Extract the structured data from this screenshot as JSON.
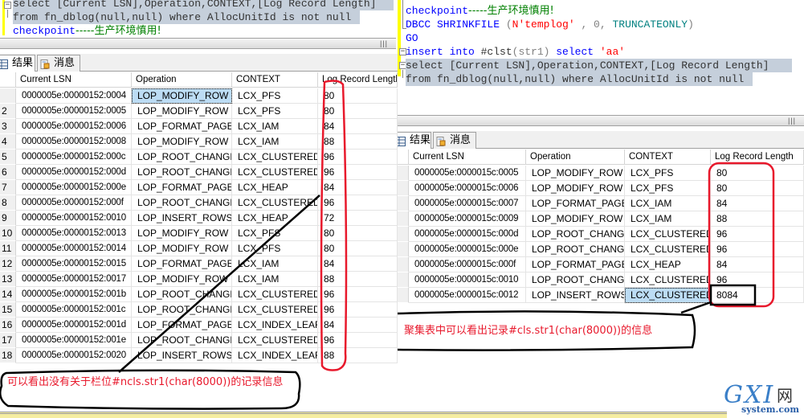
{
  "left": {
    "editor": {
      "line1": "select [Current LSN],Operation,CONTEXT,[Log Record Length]",
      "line2": "from fn_dblog(null,null) where AllocUnitId is not null",
      "line3_kw": "checkpoint",
      "line3_comment": "-----生产环境慎用!"
    },
    "tabs": [
      {
        "label": "结果",
        "icon": "grid-icon"
      },
      {
        "label": "消息",
        "icon": "message-icon"
      }
    ],
    "columns": [
      "Current LSN",
      "Operation",
      "CONTEXT",
      "Log Record Length"
    ],
    "rows": [
      {
        "n": "",
        "lsn": "0000005e:00000152:0004",
        "op": "LOP_MODIFY_ROW",
        "ctx": "LCX_PFS",
        "len": "80"
      },
      {
        "n": "2",
        "lsn": "0000005e:00000152:0005",
        "op": "LOP_MODIFY_ROW",
        "ctx": "LCX_PFS",
        "len": "80"
      },
      {
        "n": "3",
        "lsn": "0000005e:00000152:0006",
        "op": "LOP_FORMAT_PAGE",
        "ctx": "LCX_IAM",
        "len": "84"
      },
      {
        "n": "4",
        "lsn": "0000005e:00000152:0008",
        "op": "LOP_MODIFY_ROW",
        "ctx": "LCX_IAM",
        "len": "88"
      },
      {
        "n": "5",
        "lsn": "0000005e:00000152:000c",
        "op": "LOP_ROOT_CHANGE",
        "ctx": "LCX_CLUSTERED",
        "len": "96"
      },
      {
        "n": "6",
        "lsn": "0000005e:00000152:000d",
        "op": "LOP_ROOT_CHANGE",
        "ctx": "LCX_CLUSTERED",
        "len": "96"
      },
      {
        "n": "7",
        "lsn": "0000005e:00000152:000e",
        "op": "LOP_FORMAT_PAGE",
        "ctx": "LCX_HEAP",
        "len": "84"
      },
      {
        "n": "8",
        "lsn": "0000005e:00000152:000f",
        "op": "LOP_ROOT_CHANGE",
        "ctx": "LCX_CLUSTERED",
        "len": "96"
      },
      {
        "n": "9",
        "lsn": "0000005e:00000152:0010",
        "op": "LOP_INSERT_ROWS",
        "ctx": "LCX_HEAP",
        "len": "72"
      },
      {
        "n": "10",
        "lsn": "0000005e:00000152:0013",
        "op": "LOP_MODIFY_ROW",
        "ctx": "LCX_PFS",
        "len": "80"
      },
      {
        "n": "11",
        "lsn": "0000005e:00000152:0014",
        "op": "LOP_MODIFY_ROW",
        "ctx": "LCX_PFS",
        "len": "80"
      },
      {
        "n": "12",
        "lsn": "0000005e:00000152:0015",
        "op": "LOP_FORMAT_PAGE",
        "ctx": "LCX_IAM",
        "len": "84"
      },
      {
        "n": "13",
        "lsn": "0000005e:00000152:0017",
        "op": "LOP_MODIFY_ROW",
        "ctx": "LCX_IAM",
        "len": "88"
      },
      {
        "n": "14",
        "lsn": "0000005e:00000152:001b",
        "op": "LOP_ROOT_CHANGE",
        "ctx": "LCX_CLUSTERED",
        "len": "96"
      },
      {
        "n": "15",
        "lsn": "0000005e:00000152:001c",
        "op": "LOP_ROOT_CHANGE",
        "ctx": "LCX_CLUSTERED",
        "len": "96"
      },
      {
        "n": "16",
        "lsn": "0000005e:00000152:001d",
        "op": "LOP_FORMAT_PAGE",
        "ctx": "LCX_INDEX_LEAF",
        "len": "84"
      },
      {
        "n": "17",
        "lsn": "0000005e:00000152:001e",
        "op": "LOP_ROOT_CHANGE",
        "ctx": "LCX_CLUSTERED",
        "len": "96"
      },
      {
        "n": "18",
        "lsn": "0000005e:00000152:0020",
        "op": "LOP_INSERT_ROWS",
        "ctx": "LCX_INDEX_LEAF",
        "len": "88"
      }
    ],
    "annotation": "可以看出没有关于栏位#ncls.str1(char(8000))的记录信息"
  },
  "right": {
    "editor": {
      "line1_kw": "checkpoint",
      "line1_comment": "-----生产环境慎用!",
      "line2_kw": "DBCC SHRINKFILE",
      "line2_open": " (",
      "line2_str": "N'templog'",
      "line2_mid": " , 0, ",
      "line2_opt": "TRUNCATEONLY",
      "line2_close": ")",
      "line3": "GO",
      "line4_kw1": "insert into",
      "line4_tbl": " #clst",
      "line4_args": "(str1) ",
      "line4_kw2": "select",
      "line4_str": " 'aa'",
      "line5": "select [Current LSN],Operation,CONTEXT,[Log Record Length]",
      "line6": "from fn_dblog(null,null) where AllocUnitId is not null"
    },
    "tabs": [
      {
        "label": "结果",
        "icon": "grid-icon"
      },
      {
        "label": "消息",
        "icon": "message-icon"
      }
    ],
    "columns": [
      "Current LSN",
      "Operation",
      "CONTEXT",
      "Log Record Length"
    ],
    "rows": [
      {
        "lsn": "0000005e:0000015c:0005",
        "op": "LOP_MODIFY_ROW",
        "ctx": "LCX_PFS",
        "len": "80"
      },
      {
        "lsn": "0000005e:0000015c:0006",
        "op": "LOP_MODIFY_ROW",
        "ctx": "LCX_PFS",
        "len": "80"
      },
      {
        "lsn": "0000005e:0000015c:0007",
        "op": "LOP_FORMAT_PAGE",
        "ctx": "LCX_IAM",
        "len": "84"
      },
      {
        "lsn": "0000005e:0000015c:0009",
        "op": "LOP_MODIFY_ROW",
        "ctx": "LCX_IAM",
        "len": "88"
      },
      {
        "lsn": "0000005e:0000015c:000d",
        "op": "LOP_ROOT_CHANGE",
        "ctx": "LCX_CLUSTERED",
        "len": "96"
      },
      {
        "lsn": "0000005e:0000015c:000e",
        "op": "LOP_ROOT_CHANGE",
        "ctx": "LCX_CLUSTERED",
        "len": "96"
      },
      {
        "lsn": "0000005e:0000015c:000f",
        "op": "LOP_FORMAT_PAGE",
        "ctx": "LCX_HEAP",
        "len": "84"
      },
      {
        "lsn": "0000005e:0000015c:0010",
        "op": "LOP_ROOT_CHANGE",
        "ctx": "LCX_CLUSTERED",
        "len": "96"
      },
      {
        "lsn": "0000005e:0000015c:0012",
        "op": "LOP_INSERT_ROWS",
        "ctx": "LCX_CLUSTERED",
        "len": "8084"
      }
    ],
    "annotation": "聚集表中可以看出记录#cls.str1(char(8000))的信息"
  },
  "watermark": {
    "big": "GXI",
    "cn": "网",
    "domain": "system.com"
  },
  "colors": {
    "annotation_red": "#e8192c",
    "selection": "#bcdcf4",
    "sql_selection": "#c5cfdb"
  }
}
